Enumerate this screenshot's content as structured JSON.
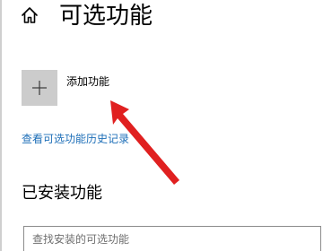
{
  "header": {
    "title": "可选功能",
    "home_icon": "home-icon"
  },
  "add_feature": {
    "icon": "plus-icon",
    "label": "添加功能"
  },
  "history_link": {
    "label": "查看可选功能历史记录"
  },
  "installed": {
    "section_title": "已安装功能",
    "search": {
      "value": "",
      "placeholder": "查找安装的可选功能"
    }
  },
  "annotation": {
    "icon": "red-arrow-icon",
    "color": "#e02020"
  },
  "colors": {
    "link": "#1e6fb8",
    "tile": "#cccccc",
    "background": "#ffffff"
  }
}
